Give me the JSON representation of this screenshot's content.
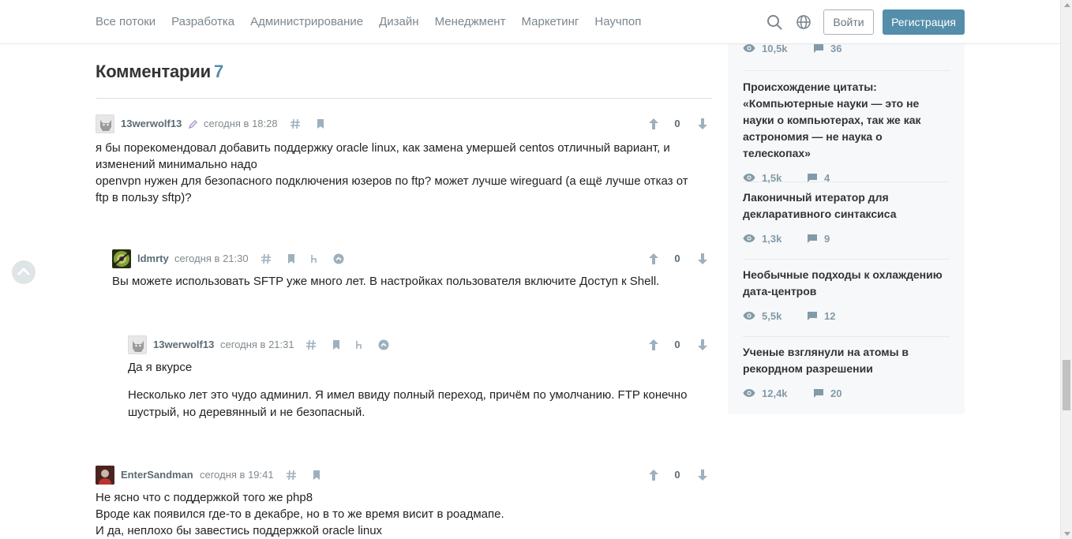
{
  "nav": {
    "items": [
      "Все потоки",
      "Разработка",
      "Администрирование",
      "Дизайн",
      "Менеджмент",
      "Маркетинг",
      "Научпоп"
    ],
    "login": "Войти",
    "register": "Регистрация",
    "accent": "#548eaa"
  },
  "comments": {
    "title": "Комментарии",
    "count": "7",
    "list": [
      {
        "user": "13werwolf13",
        "time": "сегодня в 18:28",
        "score": "0",
        "lines": [
          "я бы порекомендовал добавить поддержку oracle linux, как замена умершей centos отличный вариант, и изменений минимально надо",
          "openvpn нужен для безопасного подключения юзеров по ftp? может лучше wireguard (а ещё лучше отказ от ftp в пользу sftp)?"
        ]
      },
      {
        "user": "ldmrty",
        "time": "сегодня в 21:30",
        "score": "0",
        "lines": [
          "Вы можете использовать SFTP уже много лет. В настройках пользователя включите Доступ к Shell."
        ]
      },
      {
        "user": "13werwolf13",
        "time": "сегодня в 21:31",
        "score": "0",
        "lines": [
          "Да я вкурсе",
          "Несколько лет это чудо админил. Я имел ввиду полный переход, причём по умолчанию. FTP конечно шустрый, но деревянный и не безопасный."
        ]
      },
      {
        "user": "EnterSandman",
        "time": "сегодня в 19:41",
        "score": "0",
        "lines": [
          "Не ясно что с поддержкой того же php8",
          "Вроде как появился где-то в декабре, но в то же время висит в роадмапе.",
          "И да, неплохо бы завестись поддержкой oracle linux"
        ]
      }
    ]
  },
  "sidebar": {
    "first_stats": {
      "views": "10,5k",
      "comments": "36"
    },
    "posts": [
      {
        "title": "Происхождение цитаты: «Компьютерные науки — это не науки о компьютерах, так же как астрономия — не наука о телескопах»",
        "views": "1,5k",
        "comments": "4"
      },
      {
        "title": "Лаконичный итератор для декларативного синтаксиса",
        "views": "1,3k",
        "comments": "9"
      },
      {
        "title": "Необычные подходы к охлаждению дата-центров",
        "views": "5,5k",
        "comments": "12"
      },
      {
        "title": "Ученые взглянули на атомы в рекордном разрешении",
        "views": "12,4k",
        "comments": "20"
      }
    ]
  }
}
